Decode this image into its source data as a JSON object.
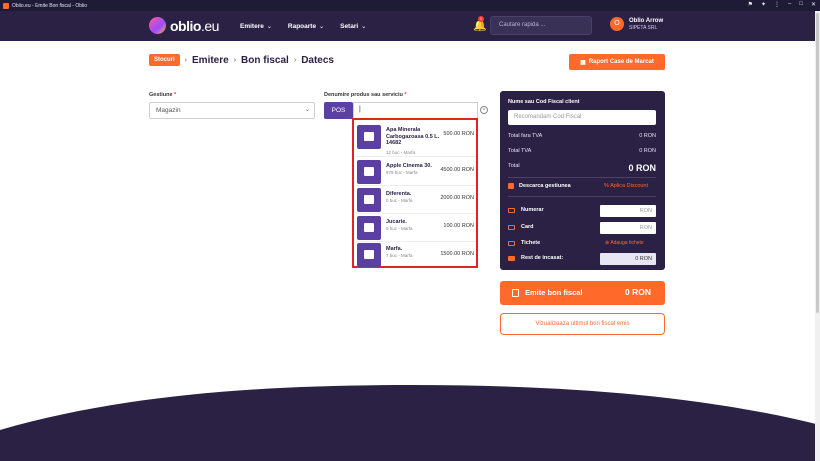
{
  "window": {
    "title": "Oblio.eu - Emite Bon fiscal - Oblio"
  },
  "navbar": {
    "logo_text": "oblio",
    "logo_suffix": ".eu",
    "menu": [
      {
        "label": "Emitere"
      },
      {
        "label": "Rapoarte"
      },
      {
        "label": "Setari"
      }
    ],
    "notification_count": "1",
    "search_placeholder": "Cautare rapida ...",
    "user_initial": "O",
    "user_name": "Oblio Arrow",
    "user_company": "SIPETA SRL"
  },
  "breadcrumb": {
    "badge": "Stocuri",
    "items": [
      "Emitere",
      "Bon fiscal",
      "Datecs"
    ]
  },
  "report_button": "Raport Case de Marcat",
  "form": {
    "gestiune_label": "Gestiune",
    "gestiune_value": "Magazin",
    "produs_label": "Denumire produs sau serviciu",
    "pos_label": "POS",
    "produs_value": "|"
  },
  "dropdown": {
    "items": [
      {
        "name": "Apa Minerala Carbogazoasa 0.5 L. 14682",
        "stock": "12 buc - Marfa",
        "price": "500.00 RON"
      },
      {
        "name": "Apple Cinema 30.",
        "stock": "978 buc - Marfa",
        "price": "4500.00 RON"
      },
      {
        "name": "Diferenta.",
        "stock": "0 buc - Marfa",
        "price": "2000.00 RON"
      },
      {
        "name": "Jucarie.",
        "stock": "5 buc - Marfa",
        "price": "100.00 RON"
      },
      {
        "name": "Marfa.",
        "stock": "7 buc - Marfa",
        "price": "1500.00 RON"
      }
    ]
  },
  "panel": {
    "cf_label": "Nume sau Cod Fiscal client",
    "cf_placeholder": "Recomandam Cod Fiscal",
    "total_fara_tva_label": "Total fara TVA",
    "total_fara_tva": "0 RON",
    "total_tva_label": "Total TVA",
    "total_tva": "0 RON",
    "total_label": "Total",
    "total": "0 RON",
    "descarca_label": "Descarca gestiunea",
    "discount_label": "% Aplica Discount",
    "numerar_label": "Numerar",
    "numerar_placeholder": "RON",
    "card_label": "Card",
    "card_placeholder": "RON",
    "tichete_label": "Tichete",
    "add_ticket": "Adauga tichete",
    "rest_label": "Rest de incasat:",
    "rest_value": "0 RON"
  },
  "emite_button": {
    "label": "Emite bon fiscal",
    "total": "0 RON"
  },
  "last_button": "Vizualizeaza ultimul bon fiscal emis",
  "colors": {
    "brand_dark": "#2a2145",
    "accent": "#ff6a2b",
    "purple": "#5c3fa3",
    "highlight_border": "#e02424"
  }
}
